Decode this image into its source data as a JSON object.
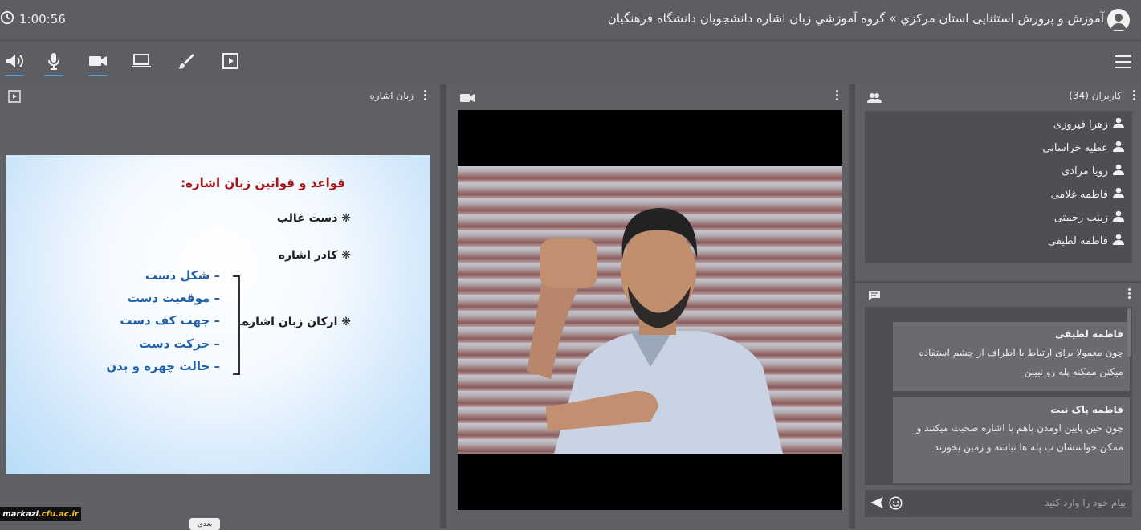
{
  "header": {
    "timer": "1:00:56",
    "title": "آموزش و پرورش استثنایی استان مرکزي » گروه آموزشي زبان اشاره دانشجويان دانشگاه فرهنگيان"
  },
  "toolbar": {
    "items": [
      "speaker-icon",
      "microphone-icon",
      "camera-icon",
      "screen-share-icon",
      "whiteboard-icon",
      "presentation-icon"
    ]
  },
  "presentation": {
    "title": "زبان اشاره",
    "slide": {
      "heading": "قواعد و قوانين زبان اشاره:",
      "bullets": [
        "❋ دست غالب",
        "❋ کادر اشاره",
        "❋ ارکان زبان اشاره"
      ],
      "sub": [
        "– شکل دست",
        "– موقعيت دست",
        "– جهت کف دست",
        "– حرکت دست",
        "– حالت چهره و بدن"
      ]
    }
  },
  "users": {
    "title": "کاربران (34)",
    "list": [
      "زهرا فیروزی",
      "عطیه خراسانی",
      "رویا مرادی",
      "فاطمه غلامی",
      "زینب رحمتی",
      "فاطمه لطیفی"
    ]
  },
  "chat": {
    "messages": [
      {
        "author": "فاطمه لطیفی",
        "text": "چون معمولا برای ارتباط با اطراف از چشم استفاده میکنن ممکنه پله رو نبینن"
      },
      {
        "author": "فاطمه پاک نیت",
        "text": "چون حین پایین اومدن باهم با اشاره صحبت میکنند و ممکن حواسشان ب پله ها نباشه و زمین بخورند"
      }
    ],
    "placeholder": "پیام خود را وارد کنید"
  },
  "brand": {
    "left": "markazi",
    "right": ".cfu.ac.ir"
  },
  "chip": "بعدی",
  "colors": {
    "accent": "#4aa3f0",
    "background": "#5f6063",
    "panel": "#4e4f52"
  }
}
